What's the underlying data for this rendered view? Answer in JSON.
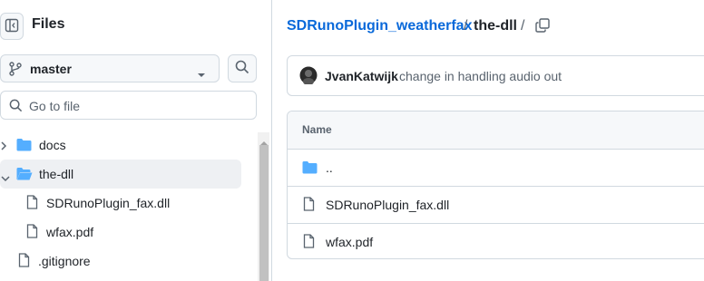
{
  "sidebar": {
    "title": "Files",
    "branch": "master",
    "goto_placeholder": "Go to file",
    "tree": [
      {
        "label": "docs",
        "type": "folder",
        "expanded": false
      },
      {
        "label": "the-dll",
        "type": "folder",
        "expanded": true,
        "selected": true
      },
      {
        "label": "SDRunoPlugin_fax.dll",
        "type": "file"
      },
      {
        "label": "wfax.pdf",
        "type": "file"
      },
      {
        "label": ".gitignore",
        "type": "file"
      }
    ]
  },
  "breadcrumb": {
    "repo": "SDRunoPlugin_weatherfax",
    "sep1": "/",
    "folder": "the-dll",
    "sep2": "/"
  },
  "commit": {
    "author": "JvanKatwijk",
    "message": "change in handling audio out"
  },
  "table": {
    "header": "Name",
    "rows": [
      {
        "name": "..",
        "type": "folder"
      },
      {
        "name": "SDRunoPlugin_fax.dll",
        "type": "file"
      },
      {
        "name": "wfax.pdf",
        "type": "file"
      }
    ]
  },
  "colors": {
    "link": "#0969da",
    "folder": "#54aeff",
    "muted": "#59636e",
    "border": "#d1d9e0"
  }
}
